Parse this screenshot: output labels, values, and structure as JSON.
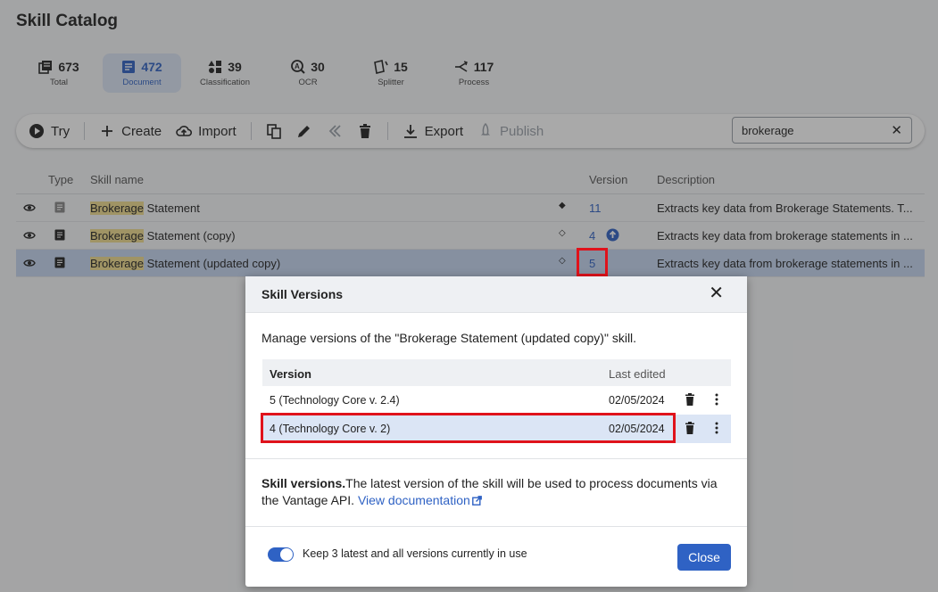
{
  "page": {
    "title": "Skill Catalog"
  },
  "stats": [
    {
      "count": "673",
      "label": "Total",
      "icon": "library-icon"
    },
    {
      "count": "472",
      "label": "Document",
      "icon": "document-icon"
    },
    {
      "count": "39",
      "label": "Classification",
      "icon": "shapes-icon"
    },
    {
      "count": "30",
      "label": "OCR",
      "icon": "ocr-icon"
    },
    {
      "count": "15",
      "label": "Splitter",
      "icon": "splitter-icon"
    },
    {
      "count": "117",
      "label": "Process",
      "icon": "process-icon"
    }
  ],
  "toolbar": {
    "try_label": "Try",
    "create_label": "Create",
    "import_label": "Import",
    "export_label": "Export",
    "publish_label": "Publish",
    "search_value": "brokerage"
  },
  "grid": {
    "headers": {
      "type": "Type",
      "name": "Skill name",
      "version": "Version",
      "description": "Description"
    },
    "rows": [
      {
        "highlight": "Brokerage",
        "name_rest": " Statement",
        "version": "11",
        "description": "Extracts key data from Brokerage Statements. T..."
      },
      {
        "highlight": "Brokerage",
        "name_rest": " Statement (copy)",
        "version": "4",
        "description": "Extracts key data from brokerage statements in ..."
      },
      {
        "highlight": "Brokerage",
        "name_rest": " Statement (updated copy)",
        "version": "5",
        "description": "Extracts key data from brokerage statements in ..."
      }
    ]
  },
  "dialog": {
    "title": "Skill Versions",
    "intro": "Manage versions of the \"Brokerage Statement (updated copy)\" skill.",
    "table": {
      "headers": {
        "version": "Version",
        "last_edited": "Last edited"
      },
      "rows": [
        {
          "version": "5 (Technology Core v. 2.4)",
          "last_edited": "02/05/2024"
        },
        {
          "version": "4 (Technology Core v. 2)",
          "last_edited": "02/05/2024"
        }
      ]
    },
    "note_bold": "Skill versions.",
    "note_text": "The latest version of the skill will be used to process documents via the Vantage API. ",
    "doc_link": "View documentation",
    "toggle_label": "Keep 3 latest and all versions currently in use",
    "close_label": "Close"
  },
  "colors": {
    "accent": "#2f62c4",
    "highlight": "#f1dd8e",
    "annotation_red": "#e0121b"
  }
}
